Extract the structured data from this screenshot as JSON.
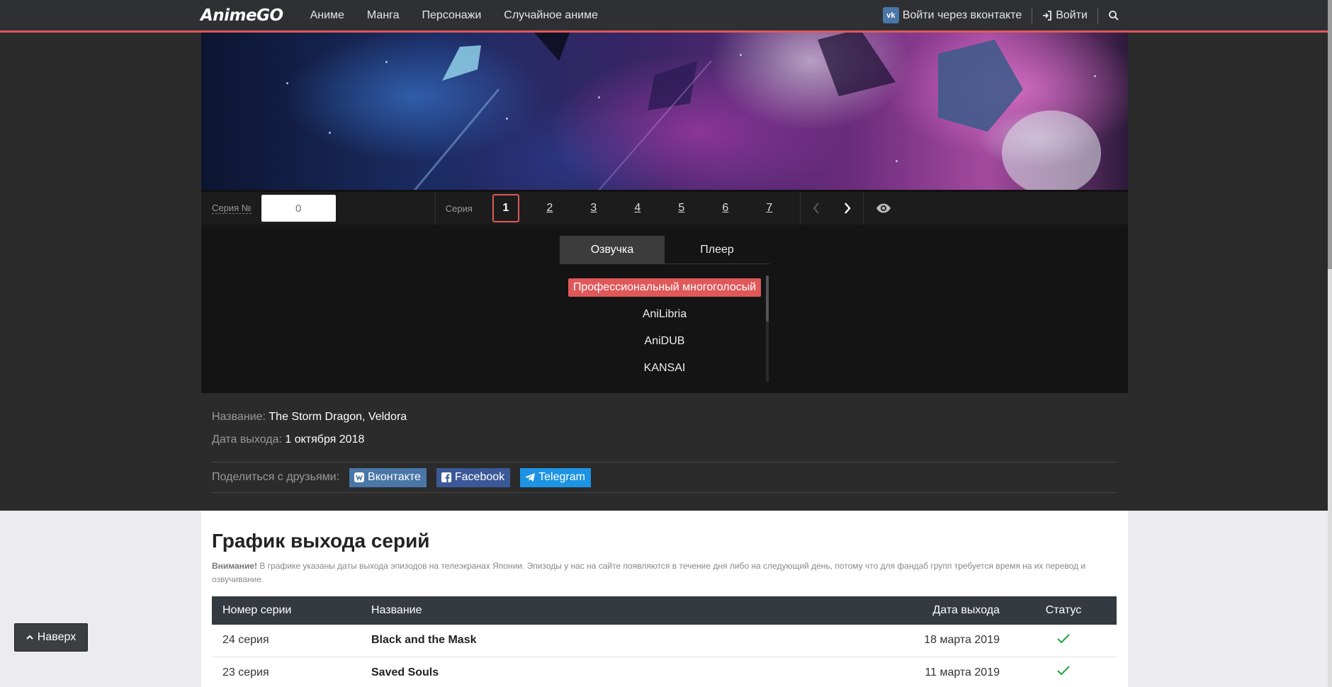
{
  "navbar": {
    "logo": "AnimeGO",
    "links": [
      "Аниме",
      "Манга",
      "Персонажи",
      "Случайное аниме"
    ],
    "vk_badge": "vk",
    "vk_login": "Войти через вконтакте",
    "login": "Войти"
  },
  "episode_bar": {
    "number_label": "Серия №",
    "number_value": "0",
    "series_label": "Серия",
    "episodes": [
      "1",
      "2",
      "3",
      "4",
      "5",
      "6",
      "7"
    ],
    "active_episode": "1"
  },
  "voice": {
    "tabs": [
      "Озвучка",
      "Плеер"
    ],
    "active_tab": "Озвучка",
    "items": [
      "Профессиональный многоголосый",
      "AniLibria",
      "AniDUB",
      "KANSAI"
    ],
    "active_item": "Профессиональный многоголосый"
  },
  "info": {
    "name_label": "Название:",
    "name_value": "The Storm Dragon, Veldora",
    "date_label": "Дата выхода:",
    "date_value": "1 октября 2018"
  },
  "share": {
    "label": "Поделиться с друзьями:",
    "buttons": [
      {
        "label": "Вконтакте",
        "color": "#4a76a8"
      },
      {
        "label": "Facebook",
        "color": "#3b5998"
      },
      {
        "label": "Telegram",
        "color": "#1c93e3"
      }
    ]
  },
  "schedule": {
    "title": "График выхода серий",
    "note_bold": "Внимание!",
    "note_text": " В графике указаны даты выхода эпизодов на телеэкранах Японии. Эпизоды у нас на сайте появляются в течение дня либо на следующий день, потому что для фандаб групп требуется время на их перевод и озвучивание.",
    "headers": [
      "Номер серии",
      "Название",
      "Дата выхода",
      "Статус"
    ],
    "rows": [
      {
        "number": "24 серия",
        "name": "Black and the Mask",
        "date": "18 марта 2019",
        "status": "released"
      },
      {
        "number": "23 серия",
        "name": "Saved Souls",
        "date": "11 марта 2019",
        "status": "released"
      }
    ]
  },
  "back_to_top": "Наверх",
  "colors": {
    "accent": "#e0585a",
    "status_ok": "#28a745"
  }
}
